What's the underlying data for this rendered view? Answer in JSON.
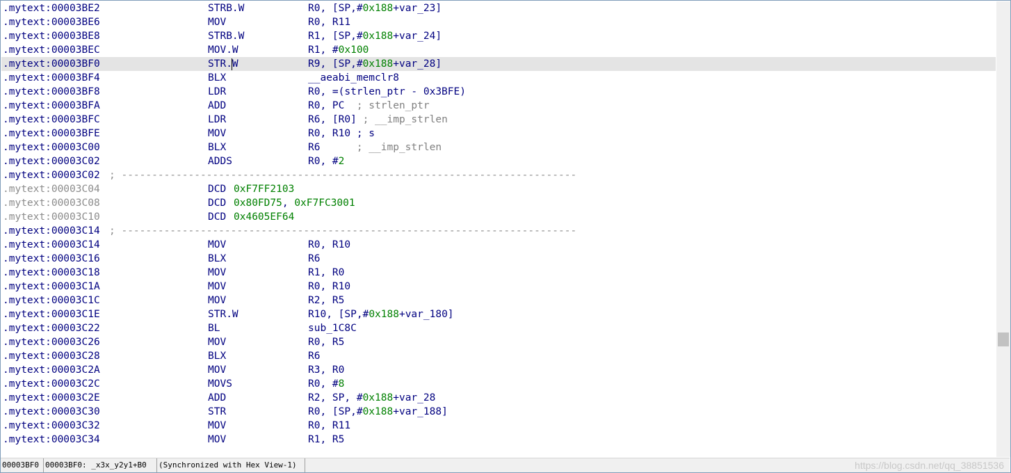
{
  "listing": {
    "rows": [
      {
        "address": ".mytext:00003BE2",
        "mnemonic": "STRB.W",
        "operands": [
          {
            "t": "R0, [SP,#"
          },
          {
            "t": "0x188",
            "c": "num"
          },
          {
            "t": "+var_23]"
          }
        ]
      },
      {
        "address": ".mytext:00003BE6",
        "mnemonic": "MOV",
        "operands": [
          {
            "t": "R0, R11"
          }
        ]
      },
      {
        "address": ".mytext:00003BE8",
        "mnemonic": "STRB.W",
        "operands": [
          {
            "t": "R1, [SP,#"
          },
          {
            "t": "0x188",
            "c": "num"
          },
          {
            "t": "+var_24]"
          }
        ]
      },
      {
        "address": ".mytext:00003BEC",
        "mnemonic": "MOV.W",
        "operands": [
          {
            "t": "R1, #"
          },
          {
            "t": "0x100",
            "c": "num"
          }
        ]
      },
      {
        "address": ".mytext:00003BF0",
        "mnemonic": "STR.W",
        "selected": true,
        "cursor": 4,
        "operands": [
          {
            "t": "R9, [SP,#"
          },
          {
            "t": "0x188",
            "c": "num"
          },
          {
            "t": "+var_28]"
          }
        ]
      },
      {
        "address": ".mytext:00003BF4",
        "mnemonic": "BLX",
        "operands": [
          {
            "t": "__aeabi_memclr8"
          }
        ]
      },
      {
        "address": ".mytext:00003BF8",
        "mnemonic": "LDR",
        "operands": [
          {
            "t": "R0, =(strlen_ptr - 0x3BFE)"
          }
        ]
      },
      {
        "address": ".mytext:00003BFA",
        "mnemonic": "ADD",
        "operands": [
          {
            "t": "R0, PC  "
          },
          {
            "t": "; strlen_ptr",
            "c": "cmt"
          }
        ]
      },
      {
        "address": ".mytext:00003BFC",
        "mnemonic": "LDR",
        "operands": [
          {
            "t": "R6, [R0] "
          },
          {
            "t": "; __imp_strlen",
            "c": "cmt"
          }
        ]
      },
      {
        "address": ".mytext:00003BFE",
        "mnemonic": "MOV",
        "operands": [
          {
            "t": "R0, R10 ; s"
          }
        ]
      },
      {
        "address": ".mytext:00003C00",
        "mnemonic": "BLX",
        "operands": [
          {
            "t": "R6      "
          },
          {
            "t": "; __imp_strlen",
            "c": "cmt"
          }
        ]
      },
      {
        "address": ".mytext:00003C02",
        "mnemonic": "ADDS",
        "operands": [
          {
            "t": "R0, #"
          },
          {
            "t": "2",
            "c": "num"
          }
        ]
      },
      {
        "address": ".mytext:00003C02",
        "separator": "; ---------------------------------------------------------------------------"
      },
      {
        "address": ".mytext:00003C04",
        "data": true,
        "mnemonic": "DCD",
        "mnemonicInline": true,
        "operands": [
          {
            "t": "0xF7FF2103",
            "c": "num"
          }
        ]
      },
      {
        "address": ".mytext:00003C08",
        "data": true,
        "mnemonic": "DCD",
        "mnemonicInline": true,
        "operands": [
          {
            "t": "0x80FD75",
            "c": "num"
          },
          {
            "t": ", "
          },
          {
            "t": "0xF7FC3001",
            "c": "num"
          }
        ]
      },
      {
        "address": ".mytext:00003C10",
        "data": true,
        "mnemonic": "DCD",
        "mnemonicInline": true,
        "operands": [
          {
            "t": "0x4605EF64",
            "c": "num"
          }
        ]
      },
      {
        "address": ".mytext:00003C14",
        "separator": "; ---------------------------------------------------------------------------"
      },
      {
        "address": ".mytext:00003C14",
        "mnemonic": "MOV",
        "operands": [
          {
            "t": "R0, R10"
          }
        ]
      },
      {
        "address": ".mytext:00003C16",
        "mnemonic": "BLX",
        "operands": [
          {
            "t": "R6"
          }
        ]
      },
      {
        "address": ".mytext:00003C18",
        "mnemonic": "MOV",
        "operands": [
          {
            "t": "R1, R0"
          }
        ]
      },
      {
        "address": ".mytext:00003C1A",
        "mnemonic": "MOV",
        "operands": [
          {
            "t": "R0, R10"
          }
        ]
      },
      {
        "address": ".mytext:00003C1C",
        "mnemonic": "MOV",
        "operands": [
          {
            "t": "R2, R5"
          }
        ]
      },
      {
        "address": ".mytext:00003C1E",
        "mnemonic": "STR.W",
        "operands": [
          {
            "t": "R10, [SP,#"
          },
          {
            "t": "0x188",
            "c": "num"
          },
          {
            "t": "+var_180]"
          }
        ]
      },
      {
        "address": ".mytext:00003C22",
        "mnemonic": "BL",
        "operands": [
          {
            "t": "sub_1C8C"
          }
        ]
      },
      {
        "address": ".mytext:00003C26",
        "mnemonic": "MOV",
        "operands": [
          {
            "t": "R0, R5"
          }
        ]
      },
      {
        "address": ".mytext:00003C28",
        "mnemonic": "BLX",
        "operands": [
          {
            "t": "R6"
          }
        ]
      },
      {
        "address": ".mytext:00003C2A",
        "mnemonic": "MOV",
        "operands": [
          {
            "t": "R3, R0"
          }
        ]
      },
      {
        "address": ".mytext:00003C2C",
        "mnemonic": "MOVS",
        "operands": [
          {
            "t": "R0, #"
          },
          {
            "t": "8",
            "c": "num"
          }
        ]
      },
      {
        "address": ".mytext:00003C2E",
        "mnemonic": "ADD",
        "operands": [
          {
            "t": "R2, SP, #"
          },
          {
            "t": "0x188",
            "c": "num"
          },
          {
            "t": "+var_28"
          }
        ]
      },
      {
        "address": ".mytext:00003C30",
        "mnemonic": "STR",
        "operands": [
          {
            "t": "R0, [SP,#"
          },
          {
            "t": "0x188",
            "c": "num"
          },
          {
            "t": "+var_188]"
          }
        ]
      },
      {
        "address": ".mytext:00003C32",
        "mnemonic": "MOV",
        "operands": [
          {
            "t": "R0, R11"
          }
        ]
      },
      {
        "address": ".mytext:00003C34",
        "mnemonic": "MOV",
        "operands": [
          {
            "t": "R1, R5"
          }
        ]
      }
    ]
  },
  "status": {
    "offset": "00003BF0",
    "location": "00003BF0: _x3x_y2y1+B0",
    "sync": "(Synchronized with Hex View-1)"
  },
  "watermark": "https://blog.csdn.net/qq_38851536",
  "colors": {
    "address": "#000080",
    "number": "#008000",
    "comment": "#808080",
    "selection": "#e4e4e4"
  }
}
